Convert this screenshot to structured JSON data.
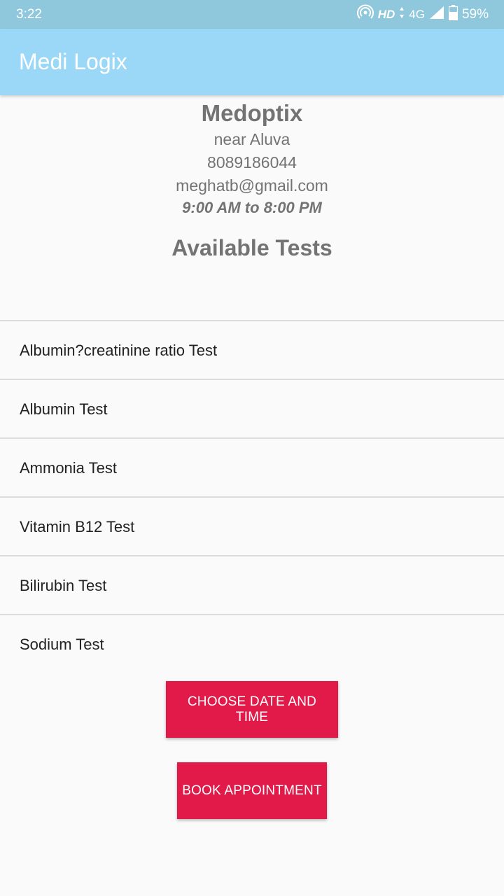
{
  "status_bar": {
    "time": "3:22",
    "hd": "HD",
    "network": "4G",
    "battery": "59%"
  },
  "app_bar": {
    "title": "Medi Logix"
  },
  "lab": {
    "name": "Medoptix",
    "address": "near Aluva",
    "phone": "8089186044",
    "email": "meghatb@gmail.com",
    "hours": "9:00 AM to 8:00 PM"
  },
  "section_title": "Available Tests",
  "tests": [
    "Albumin?creatinine ratio Test",
    "Albumin Test",
    "Ammonia Test",
    "Vitamin B12 Test",
    "Bilirubin Test",
    "Sodium Test"
  ],
  "buttons": {
    "choose_date_time": "CHOOSE DATE AND TIME",
    "book_appointment": "BOOK APPOINTMENT"
  },
  "colors": {
    "status_bar": "#8fc8dc",
    "app_bar": "#9bd8f7",
    "accent": "#e21a49"
  }
}
